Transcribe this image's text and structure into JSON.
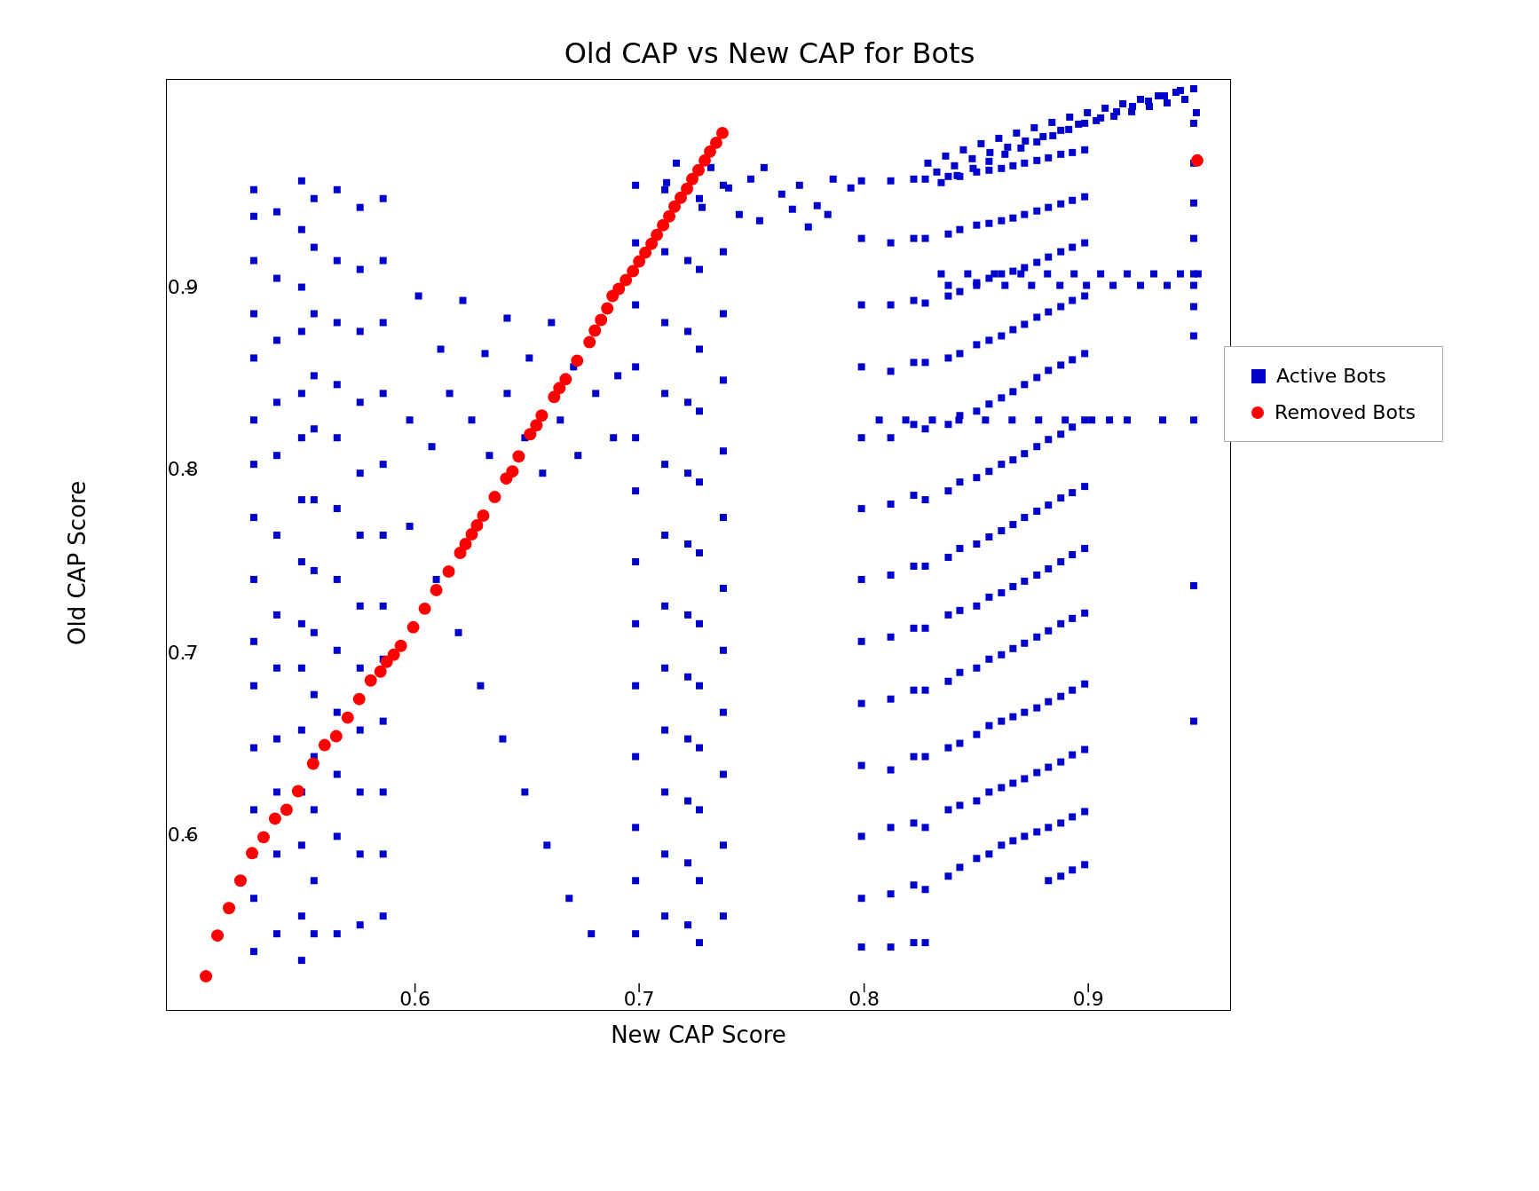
{
  "chart": {
    "title": "Old CAP vs New CAP for Bots",
    "x_axis_label": "New CAP Score",
    "y_axis_label": "Old CAP Score",
    "x_min": 0.55,
    "x_max": 1.0,
    "y_min": 0.52,
    "y_max": 1.0,
    "x_ticks": [
      0.6,
      0.7,
      0.8,
      0.9
    ],
    "y_ticks": [
      0.6,
      0.7,
      0.8,
      0.9
    ],
    "legend": {
      "items": [
        {
          "label": "Active Bots",
          "type": "square",
          "color": "#0000cd"
        },
        {
          "label": "Removed Bots",
          "type": "circle",
          "color": "#ff0000"
        }
      ]
    }
  }
}
